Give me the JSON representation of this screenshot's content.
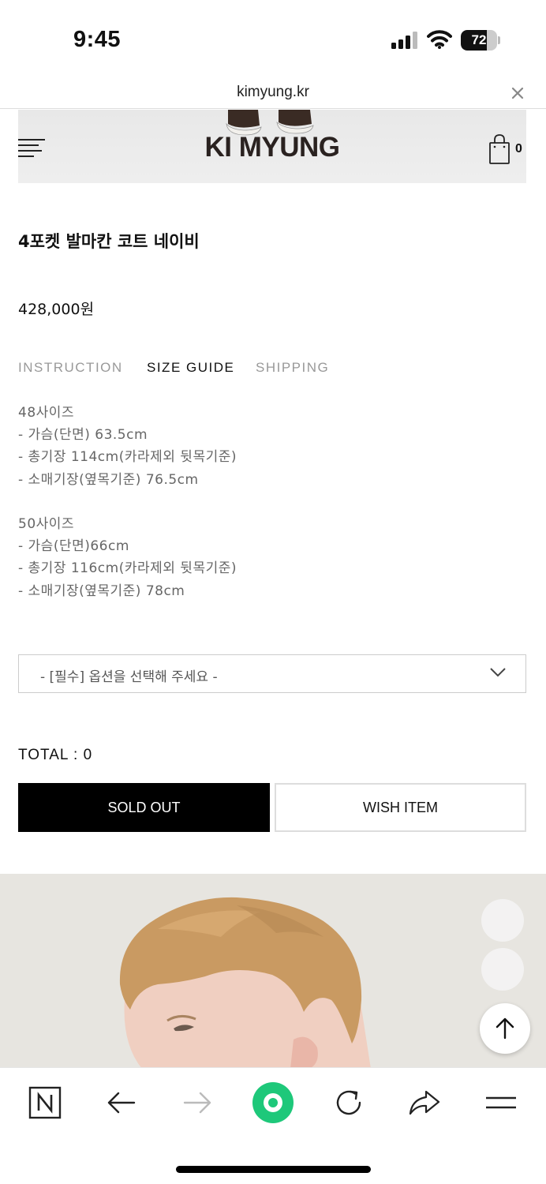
{
  "status_bar": {
    "time": "9:45",
    "battery_percent": "72",
    "battery_level": 0.72,
    "icons": [
      "cellular-signal-icon",
      "wifi-icon",
      "battery-icon"
    ]
  },
  "browser": {
    "url": "kimyung.kr",
    "close_icon": "close-icon"
  },
  "header": {
    "logo": "KI MYUNG",
    "menu_icon": "hamburger-menu-icon",
    "cart_icon": "shopping-bag-icon",
    "cart_count": "0"
  },
  "product": {
    "name": "4포켓 발마칸 코트 네이비",
    "price": "428,000원"
  },
  "tabs": [
    {
      "label": "INSTRUCTION",
      "active": false
    },
    {
      "label": "SIZE GUIDE",
      "active": true
    },
    {
      "label": "SHIPPING",
      "active": false
    }
  ],
  "size_guide": {
    "size48": {
      "title": "48사이즈",
      "lines": [
        "- 가슴(단면) 63.5cm",
        "- 총기장 114cm(카라제외 뒷목기준)",
        "- 소매기장(옆목기준) 76.5cm"
      ]
    },
    "size50": {
      "title": "50사이즈",
      "lines": [
        "- 가슴(단면)66cm",
        "- 총기장 116cm(카라제외 뒷목기준)",
        "- 소매기장(옆목기준) 78cm"
      ]
    }
  },
  "option_select": {
    "value": "- [필수] 옵션을 선택해 주세요 -"
  },
  "total": {
    "label": "TOTAL : ",
    "value": "0"
  },
  "buttons": {
    "sold_out": "SOLD OUT",
    "wish_item": "WISH ITEM"
  },
  "bottom_bar": {
    "icons": [
      "naver-home-icon",
      "back-arrow-icon",
      "forward-arrow-icon",
      "green-dot-icon",
      "reload-icon",
      "share-icon",
      "menu-icon"
    ]
  },
  "colors": {
    "accent_green": "#1ec800",
    "black": "#000000",
    "tab_inactive": "#999999"
  }
}
